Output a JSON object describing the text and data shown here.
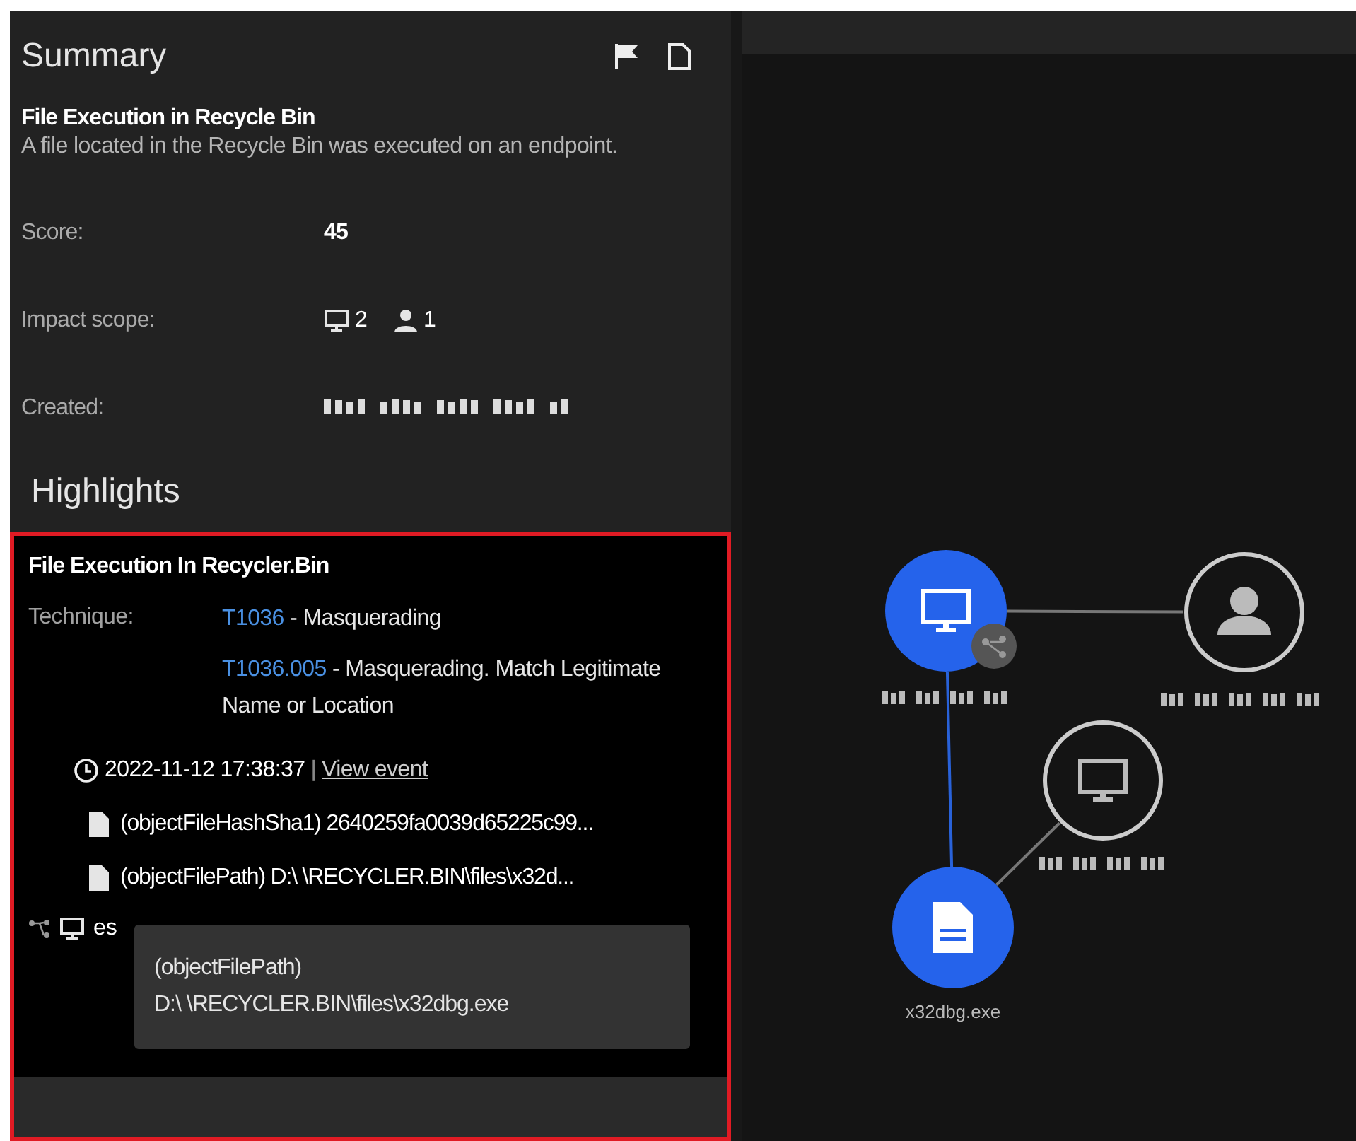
{
  "summary": {
    "title": "Summary",
    "alert_name": "File Execution in Recycle Bin",
    "description": "A file located in the Recycle Bin was executed on an endpoint.",
    "fields": [
      {
        "kind": "text",
        "label": "Score:",
        "value": "45"
      },
      {
        "kind": "scope",
        "label": "Impact scope:",
        "endpoints": "2",
        "accounts": "1"
      },
      {
        "kind": "redacted",
        "label": "Created:"
      }
    ]
  },
  "highlights": {
    "title": "Highlights",
    "card": {
      "title": "File Execution In Recycler.Bin",
      "technique_label": "Technique:",
      "techniques": [
        {
          "id": "T1036",
          "name": "- Masquerading"
        },
        {
          "id": "T1036.005",
          "name": "- Masquerading. Match Legitimate Name or Location"
        }
      ],
      "timestamp": "2022-11-12 17:38:37",
      "separator": "|",
      "link": "View event",
      "objects": [
        "(objectFileHashSha1) 2640259fa0039d65225c99...",
        "(objectFilePath) D:\\ \\RECYCLER.BIN\\files\\x32d..."
      ],
      "host_partial": "es"
    },
    "tooltip": [
      "(objectFilePath)",
      "D:\\ \\RECYCLER.BIN\\files\\x32dbg.exe"
    ]
  },
  "graph": {
    "nodes": [
      {
        "kind": "endpoint",
        "highlighted": true,
        "shared": true
      },
      {
        "kind": "user",
        "highlighted": false,
        "shared": false
      },
      {
        "kind": "endpoint",
        "highlighted": false,
        "shared": false
      },
      {
        "kind": "file",
        "highlighted": true,
        "shared": false,
        "label": "x32dbg.exe"
      }
    ],
    "edges": [
      {
        "highlighted": false
      },
      {
        "highlighted": true
      },
      {
        "highlighted": false
      }
    ]
  }
}
